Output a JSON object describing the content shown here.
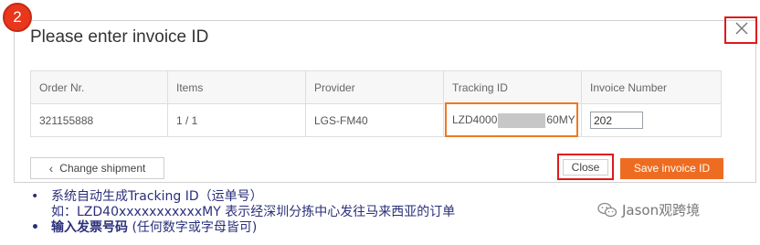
{
  "step_badge": "2",
  "dialog": {
    "title": "Please enter invoice ID",
    "close_icon": "close-x-icon"
  },
  "table": {
    "headers": [
      "Order Nr.",
      "Items",
      "Provider",
      "Tracking ID",
      "Invoice Number"
    ],
    "row": {
      "order_nr": "321155888",
      "items": "1 / 1",
      "provider": "LGS-FM40",
      "tracking_prefix": "LZD4000",
      "tracking_suffix": "60MY",
      "invoice_value": "202"
    }
  },
  "buttons": {
    "change_shipment": "Change shipment",
    "close": "Close",
    "save": "Save invoice ID"
  },
  "colors": {
    "primary_orange": "#ee6c21",
    "highlight_red": "#e0191b",
    "highlight_orange": "#f0781e",
    "note_text": "#2a2f7a"
  },
  "notes": {
    "bullet": "•",
    "line1": "系统自动生成Tracking ID（运单号）",
    "line1_sub": "如：LZD40xxxxxxxxxxxMY 表示经深圳分拣中心发往马来西亚的订单",
    "line2_strong": "输入发票号码",
    "line2_rest": " (任何数字或字母皆可)"
  },
  "watermark": {
    "icon": "wechat-icon",
    "text": "Jason观跨境"
  }
}
